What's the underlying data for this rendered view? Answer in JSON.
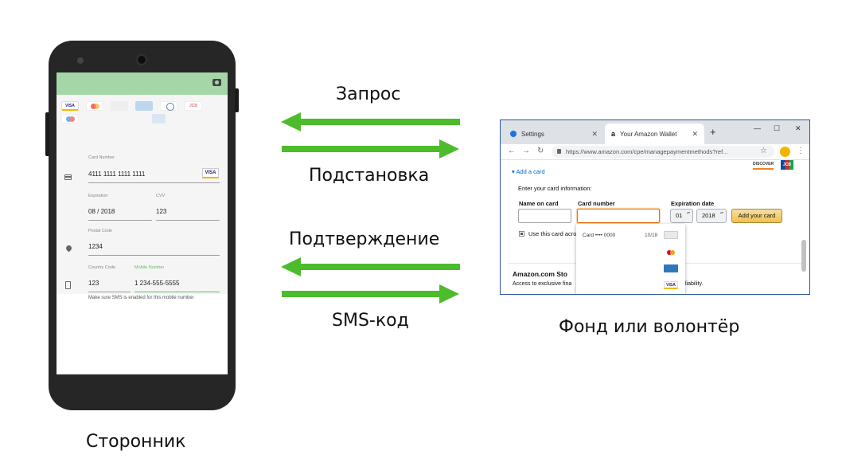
{
  "labels": {
    "request": "Запрос",
    "substitution": "Подстановка",
    "confirmation": "Подтверждение",
    "sms_code": "SMS-код",
    "third_party": "Сторонник",
    "fund": "Фонд или волонтёр"
  },
  "colors": {
    "arrow": "#4cbb2c",
    "appbar": "#a5d6a7",
    "phone_body": "#262626"
  },
  "phone": {
    "card_brands": [
      "VISA",
      "",
      "",
      "",
      "",
      "JCB",
      "",
      "UnionPay"
    ],
    "card_number_label": "Card Number",
    "card_number": "4111 1111 1111 1111",
    "card_brand_badge": "VISA",
    "expiration_label": "Expiration",
    "expiration": "08 / 2018",
    "cvv_label": "CVV",
    "cvv": "123",
    "postal_label": "Postal Code",
    "postal": "1234",
    "country_label": "Country Code",
    "country": "123",
    "mobile_label": "Mobile Number",
    "mobile": "1 234-555-5555",
    "hint": "Make sure SMS is enabled for this mobile number"
  },
  "browser": {
    "tab_settings": "Settings",
    "tab_wallet": "Your Amazon Wallet",
    "url": "https://www.amazon.com/cpe/managepaymentmethods?ref...",
    "add_card": "Add a card",
    "enter_info": "Enter your card information:",
    "name_header": "Name on card",
    "number_header": "Card number",
    "exp_header": "Expiration date",
    "month": "01",
    "year": "2018",
    "add_button": "Add your card",
    "use_card": "Use this card acro",
    "dropdown_card": "Card •••• 0000",
    "dropdown_exp": "10/18",
    "store_title": "Amazon.com Sto",
    "store_desc": "Access to exclusive fina",
    "store_desc2": "liability.",
    "discover": "DISCOVER",
    "jcb": "JCB",
    "visa": "VISA"
  }
}
